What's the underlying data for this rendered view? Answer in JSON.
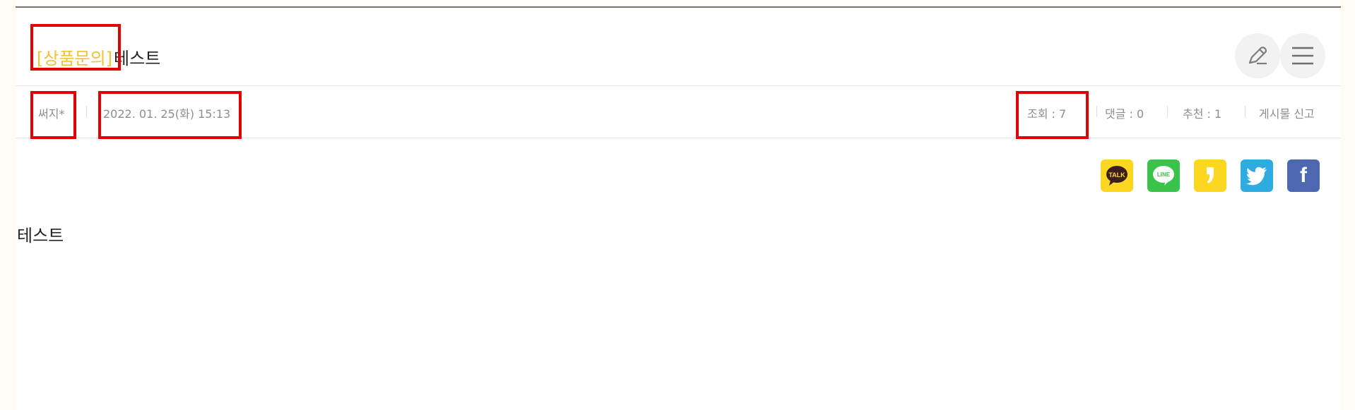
{
  "post": {
    "category": "[상품문의]",
    "title": "테스트",
    "body": "테스트"
  },
  "actions": {
    "write_icon": "pencil-icon",
    "menu_icon": "hamburger-menu-icon"
  },
  "meta": {
    "author": "써지*",
    "date": "2022. 01. 25(화) 15:13",
    "views": "조회 : 7",
    "comments": "댓글 : 0",
    "recommends": "추천 : 1",
    "report": "게시물 신고"
  },
  "share": {
    "items": [
      {
        "name": "kakaotalk",
        "label": "TALK",
        "color": "#fbd722"
      },
      {
        "name": "line",
        "label": "LINE",
        "color": "#3ac34a"
      },
      {
        "name": "kakaostory",
        "label": "",
        "color": "#fbd722"
      },
      {
        "name": "twitter",
        "label": "",
        "color": "#2eace2"
      },
      {
        "name": "facebook",
        "label": "f",
        "color": "#4b68b0"
      }
    ]
  },
  "colors": {
    "category": "#f1c232",
    "highlight": "#e00000",
    "top_rule": "#7a7667"
  }
}
